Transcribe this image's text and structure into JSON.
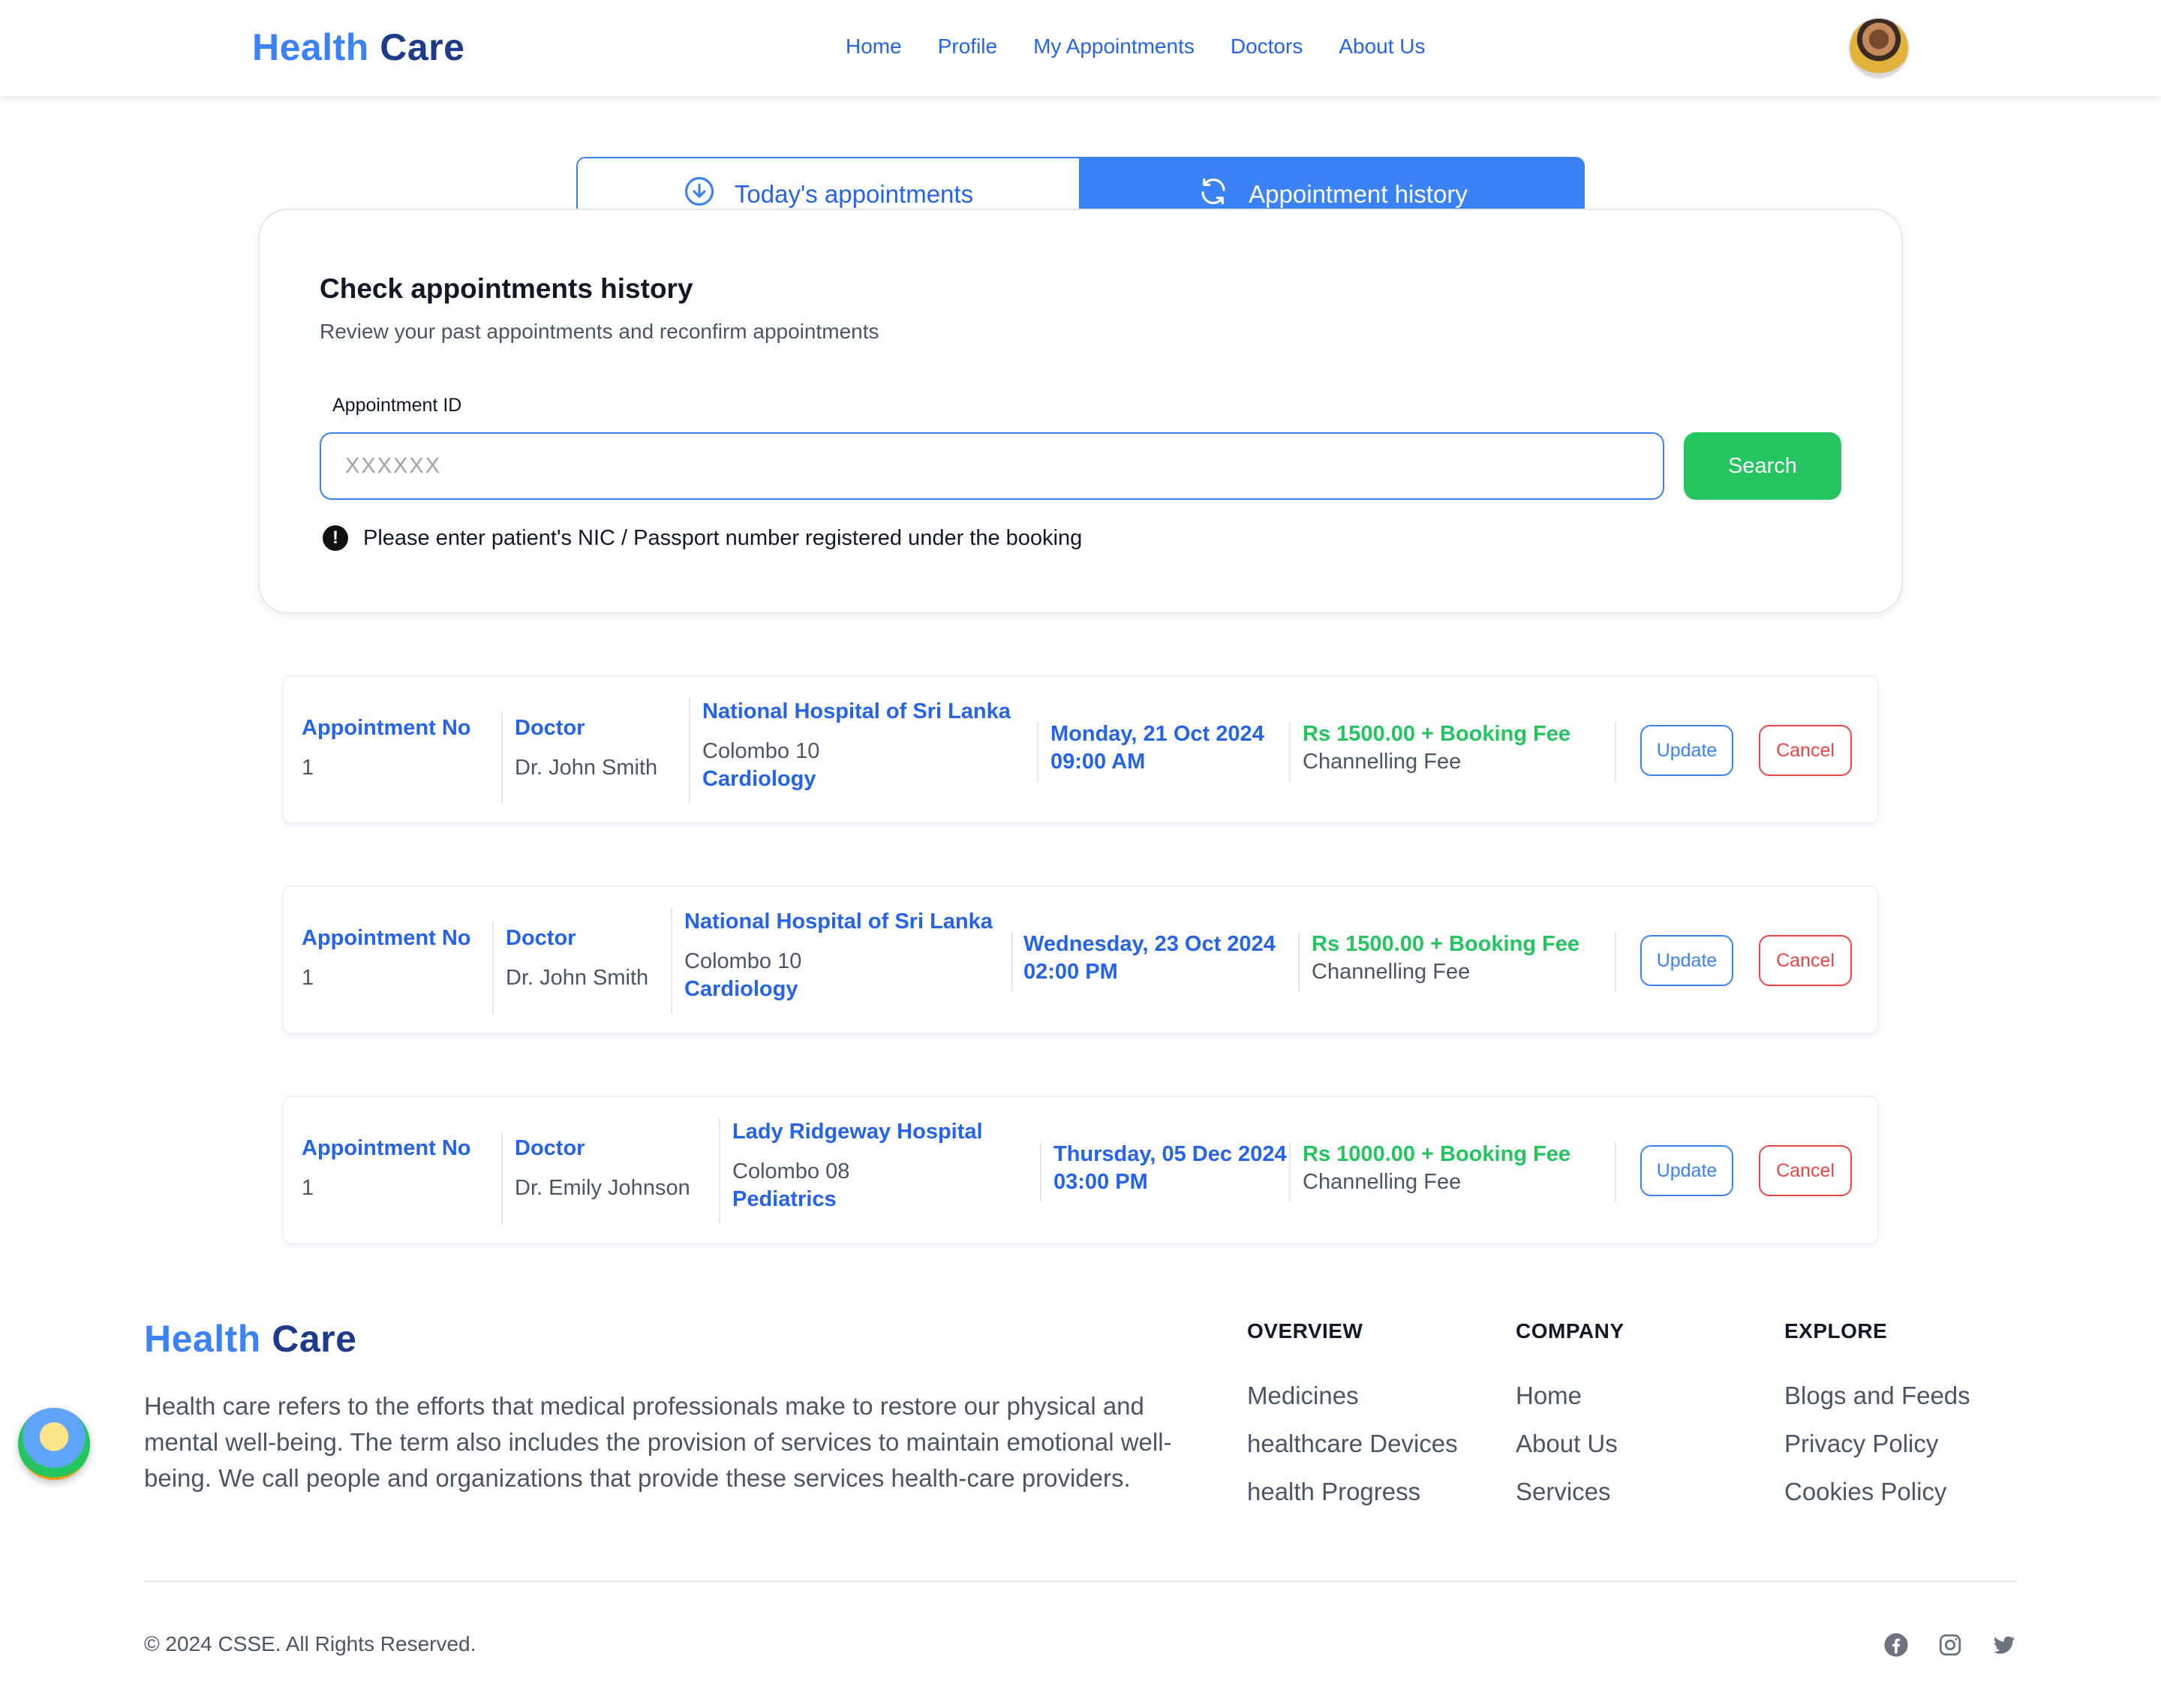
{
  "brand": {
    "part1": "Health",
    "part2": "Care"
  },
  "nav": [
    "Home",
    "Profile",
    "My Appointments",
    "Doctors",
    "About Us"
  ],
  "tabs": {
    "today": "Today's appointments",
    "history": "Appointment history"
  },
  "search": {
    "title": "Check appointments history",
    "subtitle": "Review your past appointments and reconfirm appointments",
    "label": "Appointment ID",
    "placeholder": "XXXXXX",
    "value": "",
    "button": "Search",
    "note": "Please enter patient's NIC / Passport number registered under the booking"
  },
  "appointments": [
    {
      "no_label": "Appointment No",
      "no": "1",
      "doctor_label": "Doctor",
      "doctor": "Dr. John Smith",
      "hospital": "National Hospital of Sri Lanka",
      "city": "Colombo 10",
      "specialty": "Cardiology",
      "date": "Monday, 21 Oct 2024",
      "time": "09:00 AM",
      "fee": "Rs 1500.00 + Booking Fee",
      "fee_label": "Channelling Fee",
      "update": "Update",
      "cancel": "Cancel"
    },
    {
      "no_label": "Appointment No",
      "no": "1",
      "doctor_label": "Doctor",
      "doctor": "Dr. John Smith",
      "hospital": "National Hospital of Sri Lanka",
      "city": "Colombo 10",
      "specialty": "Cardiology",
      "date": "Wednesday, 23 Oct 2024",
      "time": "02:00 PM",
      "fee": "Rs 1500.00 + Booking Fee",
      "fee_label": "Channelling Fee",
      "update": "Update",
      "cancel": "Cancel"
    },
    {
      "no_label": "Appointment No",
      "no": "1",
      "doctor_label": "Doctor",
      "doctor": "Dr. Emily Johnson",
      "hospital": "Lady Ridgeway Hospital",
      "city": "Colombo 08",
      "specialty": "Pediatrics",
      "date": "Thursday, 05 Dec 2024",
      "time": "03:00 PM",
      "fee": "Rs 1000.00 + Booking Fee",
      "fee_label": "Channelling Fee",
      "update": "Update",
      "cancel": "Cancel"
    }
  ],
  "footer": {
    "description": "Health care refers to the efforts that medical professionals make to restore our physical and mental well-being. The term also includes the provision of services to maintain emotional well-being. We call people and organizations that provide these services health-care providers.",
    "columns": [
      {
        "title": "OVERVIEW",
        "links": [
          "Medicines",
          "healthcare Devices",
          "health Progress"
        ]
      },
      {
        "title": "COMPANY",
        "links": [
          "Home",
          "About Us",
          "Services"
        ]
      },
      {
        "title": "EXPLORE",
        "links": [
          "Blogs and Feeds",
          "Privacy Policy",
          "Cookies Policy"
        ]
      }
    ],
    "copyright": "© 2024 CSSE. All Rights Reserved.",
    "social_icons": [
      "facebook-icon",
      "instagram-icon",
      "twitter-icon"
    ]
  },
  "colors": {
    "primary": "#3b82f6",
    "brand_dark": "#1e3a8a",
    "success": "#22c55e",
    "danger": "#ef4444"
  }
}
